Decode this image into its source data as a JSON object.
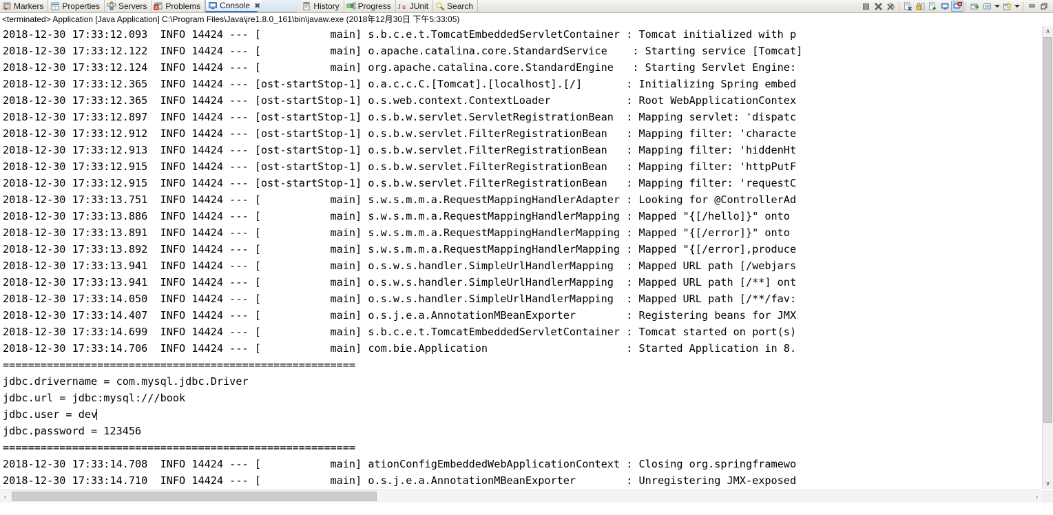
{
  "tabs": [
    {
      "label": "Markers",
      "icon": "markers-icon",
      "active": false
    },
    {
      "label": "Properties",
      "icon": "properties-icon",
      "active": false
    },
    {
      "label": "Servers",
      "icon": "servers-icon",
      "active": false
    },
    {
      "label": "Problems",
      "icon": "problems-icon",
      "active": false
    },
    {
      "label": "Console",
      "icon": "console-icon",
      "active": true,
      "close": "✖"
    },
    {
      "label": "History",
      "icon": "history-icon",
      "active": false
    },
    {
      "label": "Progress",
      "icon": "progress-icon",
      "active": false
    },
    {
      "label": "JUnit",
      "icon": "junit-icon",
      "active": false
    },
    {
      "label": "Search",
      "icon": "search-icon",
      "active": false
    }
  ],
  "toolbar": {
    "buttons": [
      {
        "name": "terminate-button",
        "title": "Terminate"
      },
      {
        "name": "remove-launch-button",
        "title": "Remove Launch"
      },
      {
        "name": "remove-all-terminated-button",
        "title": "Remove All Terminated Launches"
      },
      {
        "name": "clear-console-button",
        "title": "Clear Console"
      },
      {
        "name": "scroll-lock-button",
        "title": "Scroll Lock"
      },
      {
        "name": "word-wrap-button",
        "title": "Word Wrap"
      },
      {
        "name": "pin-console-button",
        "title": "Pin Console"
      },
      {
        "name": "display-selected-console-button",
        "title": "Display Selected Console"
      },
      {
        "name": "open-console-button",
        "title": "Open Console"
      },
      {
        "name": "minimize-button",
        "title": "Minimize"
      },
      {
        "name": "maximize-button",
        "title": "Maximize"
      }
    ]
  },
  "process_line": "<terminated> Application [Java Application] C:\\Program Files\\Java\\jre1.8.0_161\\bin\\javaw.exe (2018年12月30日 下午5:33:05)",
  "console": {
    "lines": [
      "2018-12-30 17:33:12.093  INFO 14424 --- [           main] s.b.c.e.t.TomcatEmbeddedServletContainer : Tomcat initialized with p",
      "2018-12-30 17:33:12.122  INFO 14424 --- [           main] o.apache.catalina.core.StandardService    : Starting service [Tomcat]",
      "2018-12-30 17:33:12.124  INFO 14424 --- [           main] org.apache.catalina.core.StandardEngine   : Starting Servlet Engine: ",
      "2018-12-30 17:33:12.365  INFO 14424 --- [ost-startStop-1] o.a.c.c.C.[Tomcat].[localhost].[/]       : Initializing Spring embed",
      "2018-12-30 17:33:12.365  INFO 14424 --- [ost-startStop-1] o.s.web.context.ContextLoader            : Root WebApplicationContex",
      "2018-12-30 17:33:12.897  INFO 14424 --- [ost-startStop-1] o.s.b.w.servlet.ServletRegistrationBean  : Mapping servlet: 'dispatc",
      "2018-12-30 17:33:12.912  INFO 14424 --- [ost-startStop-1] o.s.b.w.servlet.FilterRegistrationBean   : Mapping filter: 'characte",
      "2018-12-30 17:33:12.913  INFO 14424 --- [ost-startStop-1] o.s.b.w.servlet.FilterRegistrationBean   : Mapping filter: 'hiddenHt",
      "2018-12-30 17:33:12.915  INFO 14424 --- [ost-startStop-1] o.s.b.w.servlet.FilterRegistrationBean   : Mapping filter: 'httpPutF",
      "2018-12-30 17:33:12.915  INFO 14424 --- [ost-startStop-1] o.s.b.w.servlet.FilterRegistrationBean   : Mapping filter: 'requestC",
      "2018-12-30 17:33:13.751  INFO 14424 --- [           main] s.w.s.m.m.a.RequestMappingHandlerAdapter : Looking for @ControllerAd",
      "2018-12-30 17:33:13.886  INFO 14424 --- [           main] s.w.s.m.m.a.RequestMappingHandlerMapping : Mapped \"{[/hello]}\" onto ",
      "2018-12-30 17:33:13.891  INFO 14424 --- [           main] s.w.s.m.m.a.RequestMappingHandlerMapping : Mapped \"{[/error]}\" onto ",
      "2018-12-30 17:33:13.892  INFO 14424 --- [           main] s.w.s.m.m.a.RequestMappingHandlerMapping : Mapped \"{[/error],produce",
      "2018-12-30 17:33:13.941  INFO 14424 --- [           main] o.s.w.s.handler.SimpleUrlHandlerMapping  : Mapped URL path [/webjars",
      "2018-12-30 17:33:13.941  INFO 14424 --- [           main] o.s.w.s.handler.SimpleUrlHandlerMapping  : Mapped URL path [/**] ont",
      "2018-12-30 17:33:14.050  INFO 14424 --- [           main] o.s.w.s.handler.SimpleUrlHandlerMapping  : Mapped URL path [/**/fav:",
      "2018-12-30 17:33:14.407  INFO 14424 --- [           main] o.s.j.e.a.AnnotationMBeanExporter        : Registering beans for JMX",
      "2018-12-30 17:33:14.699  INFO 14424 --- [           main] s.b.c.e.t.TomcatEmbeddedServletContainer : Tomcat started on port(s)",
      "2018-12-30 17:33:14.706  INFO 14424 --- [           main] com.bie.Application                      : Started Application in 8.",
      "========================================================",
      "jdbc.drivername = com.mysql.jdbc.Driver",
      "jdbc.url = jdbc:mysql:///book",
      "jdbc.user = dev",
      "jdbc.password = 123456",
      "========================================================",
      "2018-12-30 17:33:14.708  INFO 14424 --- [           main] ationConfigEmbeddedWebApplicationContext : Closing org.springframewo",
      "2018-12-30 17:33:14.710  INFO 14424 --- [           main] o.s.j.e.a.AnnotationMBeanExporter        : Unregistering JMX-exposed"
    ],
    "caret_line_index": 23
  },
  "scrollbars": {
    "up_arrow": "∧",
    "down_arrow": "∨",
    "left_arrow": "‹",
    "right_arrow": "›"
  }
}
